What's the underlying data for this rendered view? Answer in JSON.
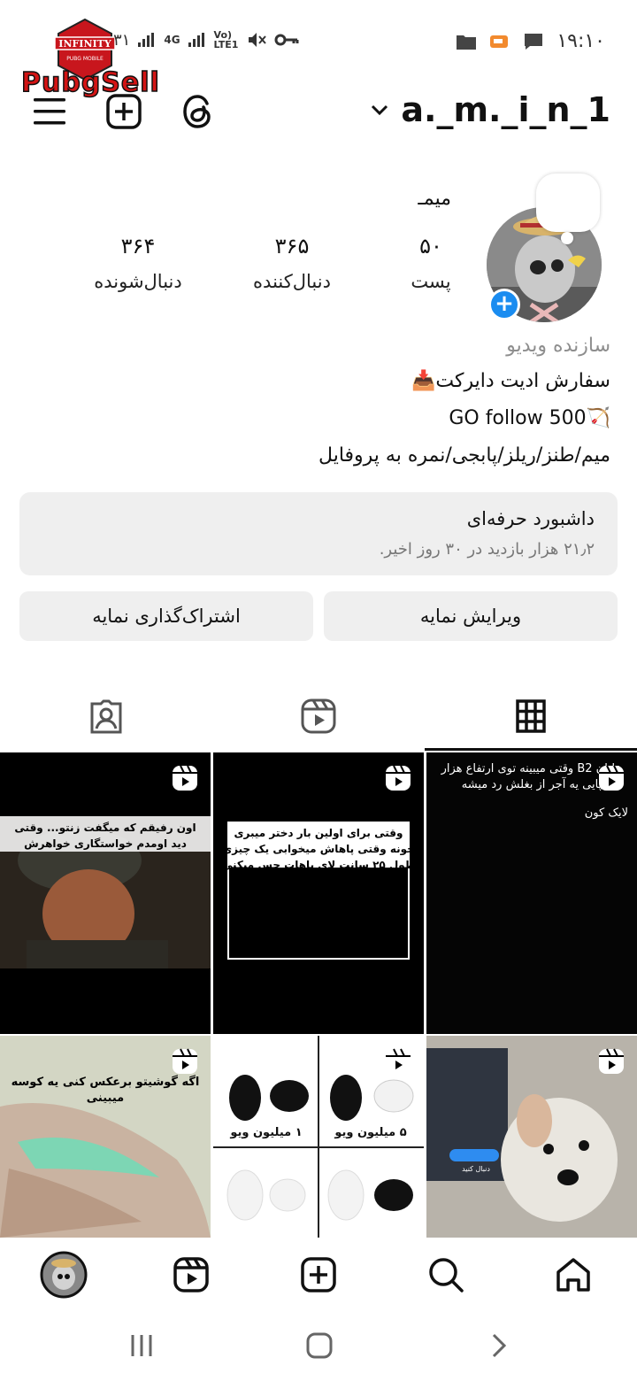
{
  "status_bar": {
    "time": "۱۹:۱۰",
    "battery": "۳۱",
    "network": "4G",
    "volte": "Vo) LTE1",
    "logo_badge_text": "INFINITY",
    "logo_badge_sub": "PUBG MOBILE",
    "logo_word": "PubgSell"
  },
  "header": {
    "username": "a._m._i_n_1"
  },
  "profile": {
    "name": "میمـ",
    "stats": [
      {
        "value": "۵۰",
        "label": "پست"
      },
      {
        "value": "۳۶۵",
        "label": "دنبال‌کننده"
      },
      {
        "value": "۳۶۴",
        "label": "دنبال‌شونده"
      }
    ],
    "category": "سازنده ویدیو",
    "bio": [
      "سفارش ادیت دایرکت📥",
      "GO follow 500🏹",
      "میم/طنز/ریلز/پابجی/نمره به پروفایل"
    ]
  },
  "dashboard": {
    "title": "داشبورد حرفه‌ای",
    "subtitle": "۲۱٫۲ هزار بازدید در ۳۰ روز اخیر."
  },
  "buttons": {
    "edit": "ویرایش نمایه",
    "share": "اشتراک‌گذاری نمایه"
  },
  "tabs": [
    {
      "icon": "grid-icon"
    },
    {
      "icon": "reels-icon"
    },
    {
      "icon": "tagged-icon"
    }
  ],
  "posts": [
    {
      "text": "اون رفیقم که میگفت زنتو... وقتی دید اومدم خواستگاری خواهرش"
    },
    {
      "text": "وقتی برای اولین بار دختر میبری خونه وقتی پاهاش میخوابی یک چیزی طول ۲۵ سانت لای پاهات حس میکنی"
    },
    {
      "text": "خلبان B2 وقتی میبینه توی ارتفاع هزار پایی یه آجر از بغلش رد میشه",
      "sub": "لایک کون"
    },
    {
      "text": "اگه گوشیتو برعکس کنی یه کوسه میبینی"
    },
    {
      "labels": [
        "۱ میلیون ویو",
        "۵ میلیون ویو"
      ]
    },
    {
      "text": "دنبال کنید"
    }
  ],
  "colors": {
    "accent": "#1a8cf0",
    "button_bg": "#efefef",
    "muted": "#8e8e8e",
    "logo_red": "#d31414"
  }
}
